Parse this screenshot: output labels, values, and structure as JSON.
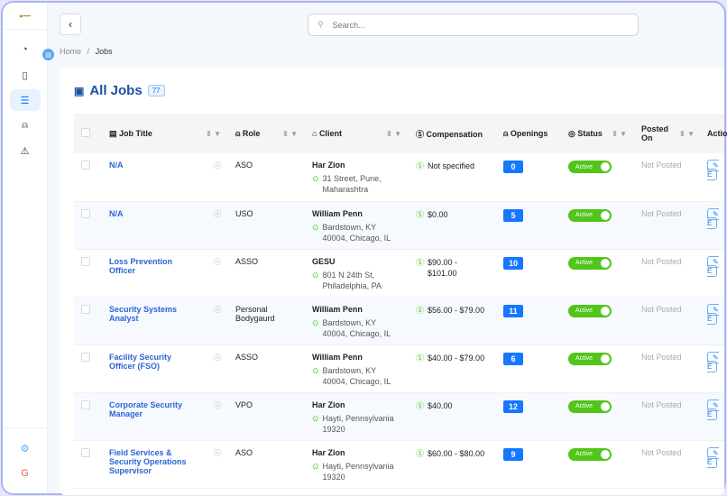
{
  "logo": "logo",
  "search": {
    "placeholder": "Search..."
  },
  "breadcrumb": {
    "home": "Home",
    "sep": "/",
    "current": "Jobs"
  },
  "page": {
    "title": "All Jobs",
    "count": "77"
  },
  "columns": {
    "job_title": "Job Title",
    "role": "Role",
    "client": "Client",
    "compensation": "Compensation",
    "openings": "Openings",
    "status": "Status",
    "posted_on": "Posted On",
    "actions": "Actions"
  },
  "rows": [
    {
      "title": "N/A",
      "role": "ASO",
      "client": "Har Zion",
      "address": "31 Street, Pune, Maharashtra",
      "comp": "Not specified",
      "openings": "0",
      "status": "Active",
      "posted": "Not Posted",
      "edit": "E"
    },
    {
      "title": "N/A",
      "role": "USO",
      "client": "William Penn",
      "address": "Bardstown, KY 40004, Chicago, IL",
      "comp": "$0.00",
      "openings": "5",
      "status": "Active",
      "posted": "Not Posted",
      "edit": "E"
    },
    {
      "title": "Loss Prevention Officer",
      "role": "ASSO",
      "client": "GESU",
      "address": "801 N 24th St, Philadelphia, PA",
      "comp": "$90.00 - $101.00",
      "openings": "10",
      "status": "Active",
      "posted": "Not Posted",
      "edit": "E"
    },
    {
      "title": "Security Systems Analyst",
      "role": "Personal Bodygaurd",
      "client": "William Penn",
      "address": "Bardstown, KY 40004, Chicago, IL",
      "comp": "$56.00 - $79.00",
      "openings": "11",
      "status": "Active",
      "posted": "Not Posted",
      "edit": "E"
    },
    {
      "title": "Facility Security Officer (FSO)",
      "role": "ASSO",
      "client": "William Penn",
      "address": "Bardstown, KY 40004, Chicago, IL",
      "comp": "$40.00 - $79.00",
      "openings": "6",
      "status": "Active",
      "posted": "Not Posted",
      "edit": "E"
    },
    {
      "title": "Corporate Security Manager",
      "role": "VPO",
      "client": "Har Zion",
      "address": "Hayti, Pennsylvania 19320",
      "comp": "$40.00",
      "openings": "12",
      "status": "Active",
      "posted": "Not Posted",
      "edit": "E"
    },
    {
      "title": "Field Services & Security Operations Supervisor",
      "role": "ASO",
      "client": "Har Zion",
      "address": "Hayti, Pennsylvania 19320",
      "comp": "$60.00 - $80.00",
      "openings": "9",
      "status": "Active",
      "posted": "Not Posted",
      "edit": "E"
    }
  ]
}
